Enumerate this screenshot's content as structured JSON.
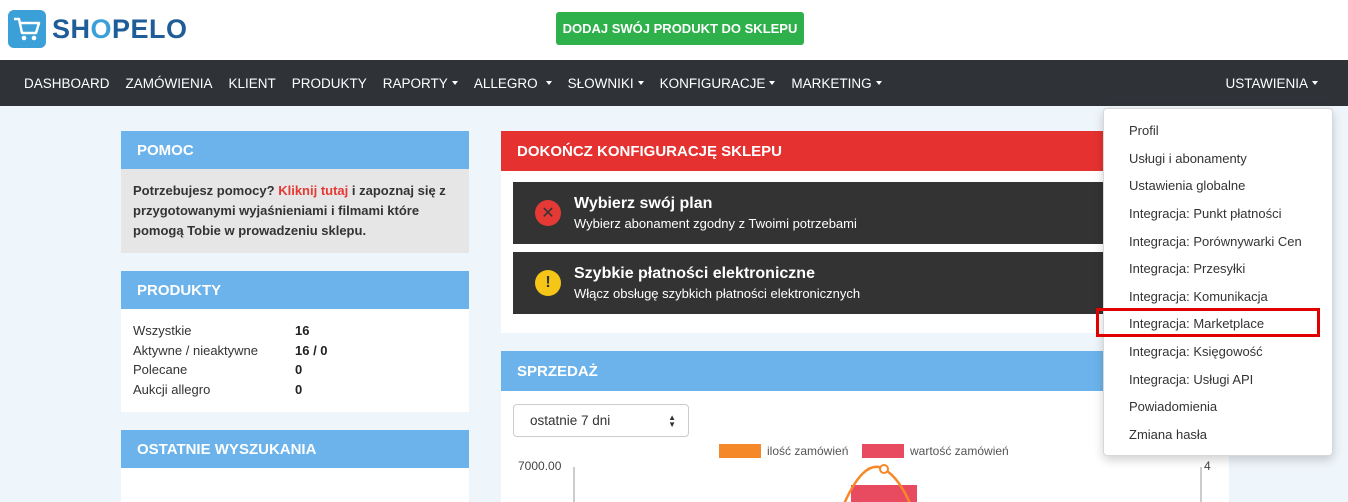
{
  "header": {
    "logo_text_pre": "SH",
    "logo_text_o": "O",
    "logo_text_post": "PELO",
    "cta_label": "DODAJ SWÓJ PRODUKT DO SKLEPU"
  },
  "nav": {
    "items": [
      {
        "label": "DASHBOARD",
        "dropdown": false
      },
      {
        "label": "ZAMÓWIENIA",
        "dropdown": false
      },
      {
        "label": "KLIENT",
        "dropdown": false
      },
      {
        "label": "PRODUKTY",
        "dropdown": false
      },
      {
        "label": "RAPORTY",
        "dropdown": true
      },
      {
        "label": "ALLEGRO",
        "dropdown": true
      },
      {
        "label": "SŁOWNIKI",
        "dropdown": true
      },
      {
        "label": "KONFIGURACJE",
        "dropdown": true
      },
      {
        "label": "MARKETING",
        "dropdown": true
      }
    ],
    "settings_label": "USTAWIENIA"
  },
  "pomoc": {
    "title": "POMOC",
    "text_before": "Potrzebujesz pomocy? ",
    "link": "Kliknij tutaj",
    "text_after": " i zapoznaj się z przygotowanymi wyjaśnieniami i filmami które pomogą Tobie w prowadzeniu sklepu."
  },
  "produkty": {
    "title": "PRODUKTY",
    "rows": [
      {
        "label": "Wszystkie",
        "value": "16"
      },
      {
        "label": "Aktywne / nieaktywne",
        "value": "16 / 0"
      },
      {
        "label": "Polecane",
        "value": "0"
      },
      {
        "label": "Aukcji allegro",
        "value": "0"
      }
    ]
  },
  "ostatnie": {
    "title": "OSTATNIE WYSZUKANIA"
  },
  "konfig": {
    "title": "DOKOŃCZ KONFIGURACJĘ SKLEPU",
    "alerts": [
      {
        "title": "Wybierz swój plan",
        "text": "Wybierz abonament zgodny z Twoimi potrzebami",
        "icon": "error-icon",
        "color": "#e53935"
      },
      {
        "title": "Szybkie płatności elektroniczne",
        "text": "Włącz obsługę szybkich płatności elektronicznych",
        "icon": "warning-icon",
        "color": "#f5c518"
      }
    ]
  },
  "sprzedaz": {
    "title": "SPRZEDAŻ",
    "period": "ostatnie 7 dni",
    "legend": [
      {
        "name": "ilość zamówień",
        "color": "#f5892a"
      },
      {
        "name": "wartość zamówień",
        "color": "#e84a5f"
      }
    ],
    "y_left_top": "7000.00",
    "y_right_top": "4"
  },
  "settings_menu": {
    "items": [
      "Profil",
      "Usługi i abonamenty",
      "Ustawienia globalne",
      "Integracja: Punkt płatności",
      "Integracja: Porównywarki Cen",
      "Integracja: Przesyłki",
      "Integracja: Komunikacja",
      "Integracja: Marketplace",
      "Integracja: Księgowość",
      "Integracja: Usługi API",
      "Powiadomienia",
      "Zmiana hasła"
    ],
    "highlighted_index": 7
  }
}
